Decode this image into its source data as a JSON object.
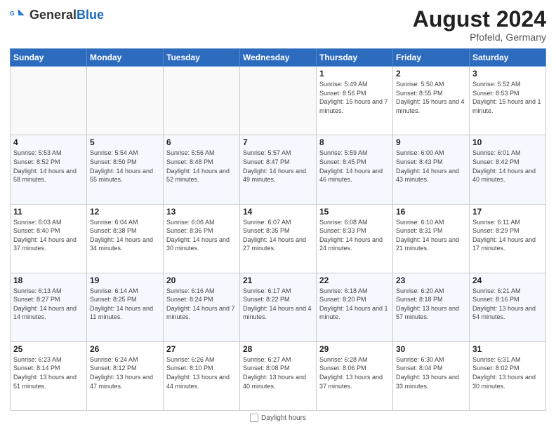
{
  "header": {
    "logo_general": "General",
    "logo_blue": "Blue",
    "month_year": "August 2024",
    "location": "Pfofeld, Germany"
  },
  "days_of_week": [
    "Sunday",
    "Monday",
    "Tuesday",
    "Wednesday",
    "Thursday",
    "Friday",
    "Saturday"
  ],
  "weeks": [
    [
      {
        "day": "",
        "sunrise": "",
        "sunset": "",
        "daylight": "",
        "empty": true
      },
      {
        "day": "",
        "sunrise": "",
        "sunset": "",
        "daylight": "",
        "empty": true
      },
      {
        "day": "",
        "sunrise": "",
        "sunset": "",
        "daylight": "",
        "empty": true
      },
      {
        "day": "",
        "sunrise": "",
        "sunset": "",
        "daylight": "",
        "empty": true
      },
      {
        "day": "1",
        "sunrise": "Sunrise: 5:49 AM",
        "sunset": "Sunset: 8:56 PM",
        "daylight": "Daylight: 15 hours and 7 minutes.",
        "empty": false
      },
      {
        "day": "2",
        "sunrise": "Sunrise: 5:50 AM",
        "sunset": "Sunset: 8:55 PM",
        "daylight": "Daylight: 15 hours and 4 minutes.",
        "empty": false
      },
      {
        "day": "3",
        "sunrise": "Sunrise: 5:52 AM",
        "sunset": "Sunset: 8:53 PM",
        "daylight": "Daylight: 15 hours and 1 minute.",
        "empty": false
      }
    ],
    [
      {
        "day": "4",
        "sunrise": "Sunrise: 5:53 AM",
        "sunset": "Sunset: 8:52 PM",
        "daylight": "Daylight: 14 hours and 58 minutes.",
        "empty": false
      },
      {
        "day": "5",
        "sunrise": "Sunrise: 5:54 AM",
        "sunset": "Sunset: 8:50 PM",
        "daylight": "Daylight: 14 hours and 55 minutes.",
        "empty": false
      },
      {
        "day": "6",
        "sunrise": "Sunrise: 5:56 AM",
        "sunset": "Sunset: 8:48 PM",
        "daylight": "Daylight: 14 hours and 52 minutes.",
        "empty": false
      },
      {
        "day": "7",
        "sunrise": "Sunrise: 5:57 AM",
        "sunset": "Sunset: 8:47 PM",
        "daylight": "Daylight: 14 hours and 49 minutes.",
        "empty": false
      },
      {
        "day": "8",
        "sunrise": "Sunrise: 5:59 AM",
        "sunset": "Sunset: 8:45 PM",
        "daylight": "Daylight: 14 hours and 46 minutes.",
        "empty": false
      },
      {
        "day": "9",
        "sunrise": "Sunrise: 6:00 AM",
        "sunset": "Sunset: 8:43 PM",
        "daylight": "Daylight: 14 hours and 43 minutes.",
        "empty": false
      },
      {
        "day": "10",
        "sunrise": "Sunrise: 6:01 AM",
        "sunset": "Sunset: 8:42 PM",
        "daylight": "Daylight: 14 hours and 40 minutes.",
        "empty": false
      }
    ],
    [
      {
        "day": "11",
        "sunrise": "Sunrise: 6:03 AM",
        "sunset": "Sunset: 8:40 PM",
        "daylight": "Daylight: 14 hours and 37 minutes.",
        "empty": false
      },
      {
        "day": "12",
        "sunrise": "Sunrise: 6:04 AM",
        "sunset": "Sunset: 8:38 PM",
        "daylight": "Daylight: 14 hours and 34 minutes.",
        "empty": false
      },
      {
        "day": "13",
        "sunrise": "Sunrise: 6:06 AM",
        "sunset": "Sunset: 8:36 PM",
        "daylight": "Daylight: 14 hours and 30 minutes.",
        "empty": false
      },
      {
        "day": "14",
        "sunrise": "Sunrise: 6:07 AM",
        "sunset": "Sunset: 8:35 PM",
        "daylight": "Daylight: 14 hours and 27 minutes.",
        "empty": false
      },
      {
        "day": "15",
        "sunrise": "Sunrise: 6:08 AM",
        "sunset": "Sunset: 8:33 PM",
        "daylight": "Daylight: 14 hours and 24 minutes.",
        "empty": false
      },
      {
        "day": "16",
        "sunrise": "Sunrise: 6:10 AM",
        "sunset": "Sunset: 8:31 PM",
        "daylight": "Daylight: 14 hours and 21 minutes.",
        "empty": false
      },
      {
        "day": "17",
        "sunrise": "Sunrise: 6:11 AM",
        "sunset": "Sunset: 8:29 PM",
        "daylight": "Daylight: 14 hours and 17 minutes.",
        "empty": false
      }
    ],
    [
      {
        "day": "18",
        "sunrise": "Sunrise: 6:13 AM",
        "sunset": "Sunset: 8:27 PM",
        "daylight": "Daylight: 14 hours and 14 minutes.",
        "empty": false
      },
      {
        "day": "19",
        "sunrise": "Sunrise: 6:14 AM",
        "sunset": "Sunset: 8:25 PM",
        "daylight": "Daylight: 14 hours and 11 minutes.",
        "empty": false
      },
      {
        "day": "20",
        "sunrise": "Sunrise: 6:16 AM",
        "sunset": "Sunset: 8:24 PM",
        "daylight": "Daylight: 14 hours and 7 minutes.",
        "empty": false
      },
      {
        "day": "21",
        "sunrise": "Sunrise: 6:17 AM",
        "sunset": "Sunset: 8:22 PM",
        "daylight": "Daylight: 14 hours and 4 minutes.",
        "empty": false
      },
      {
        "day": "22",
        "sunrise": "Sunrise: 6:18 AM",
        "sunset": "Sunset: 8:20 PM",
        "daylight": "Daylight: 14 hours and 1 minute.",
        "empty": false
      },
      {
        "day": "23",
        "sunrise": "Sunrise: 6:20 AM",
        "sunset": "Sunset: 8:18 PM",
        "daylight": "Daylight: 13 hours and 57 minutes.",
        "empty": false
      },
      {
        "day": "24",
        "sunrise": "Sunrise: 6:21 AM",
        "sunset": "Sunset: 8:16 PM",
        "daylight": "Daylight: 13 hours and 54 minutes.",
        "empty": false
      }
    ],
    [
      {
        "day": "25",
        "sunrise": "Sunrise: 6:23 AM",
        "sunset": "Sunset: 8:14 PM",
        "daylight": "Daylight: 13 hours and 51 minutes.",
        "empty": false
      },
      {
        "day": "26",
        "sunrise": "Sunrise: 6:24 AM",
        "sunset": "Sunset: 8:12 PM",
        "daylight": "Daylight: 13 hours and 47 minutes.",
        "empty": false
      },
      {
        "day": "27",
        "sunrise": "Sunrise: 6:26 AM",
        "sunset": "Sunset: 8:10 PM",
        "daylight": "Daylight: 13 hours and 44 minutes.",
        "empty": false
      },
      {
        "day": "28",
        "sunrise": "Sunrise: 6:27 AM",
        "sunset": "Sunset: 8:08 PM",
        "daylight": "Daylight: 13 hours and 40 minutes.",
        "empty": false
      },
      {
        "day": "29",
        "sunrise": "Sunrise: 6:28 AM",
        "sunset": "Sunset: 8:06 PM",
        "daylight": "Daylight: 13 hours and 37 minutes.",
        "empty": false
      },
      {
        "day": "30",
        "sunrise": "Sunrise: 6:30 AM",
        "sunset": "Sunset: 8:04 PM",
        "daylight": "Daylight: 13 hours and 33 minutes.",
        "empty": false
      },
      {
        "day": "31",
        "sunrise": "Sunrise: 6:31 AM",
        "sunset": "Sunset: 8:02 PM",
        "daylight": "Daylight: 13 hours and 30 minutes.",
        "empty": false
      }
    ]
  ],
  "footer": {
    "daylight_label": "Daylight hours"
  }
}
